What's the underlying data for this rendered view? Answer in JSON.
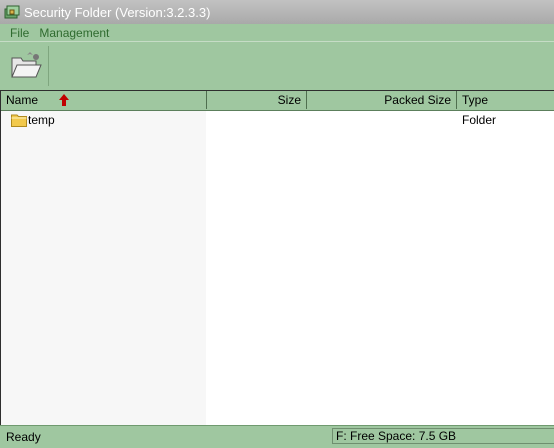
{
  "window": {
    "title": "Security Folder (Version:3.2.3.3)"
  },
  "menu": {
    "items": [
      "File",
      "Management"
    ]
  },
  "toolbar": {
    "open_icon": "open-folder-icon"
  },
  "table": {
    "columns": [
      "Name",
      "Size",
      "Packed Size",
      "Type"
    ],
    "sort": {
      "column": "Name",
      "direction": "ascending"
    },
    "rows": [
      {
        "name": "temp",
        "size": "",
        "packed_size": "",
        "type": "Folder",
        "icon": "folder-icon"
      }
    ]
  },
  "status": {
    "left": "Ready",
    "right": "F: Free Space: 7.5 GB"
  },
  "colors": {
    "background": "#9fc7a0",
    "menu_text": "#2f6b2f",
    "sort_arrow": "#c00000"
  }
}
